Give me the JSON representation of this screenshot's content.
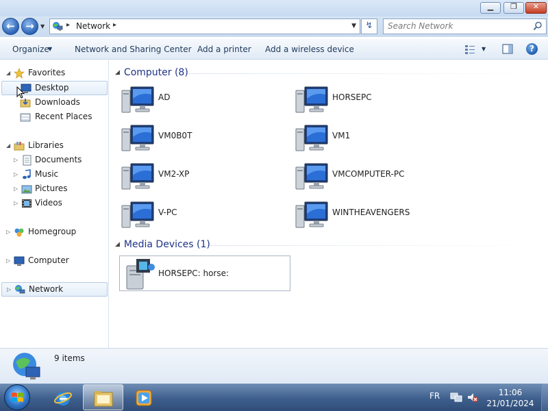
{
  "window": {
    "minimize_glyph": "▁",
    "maximize_glyph": "❐",
    "close_glyph": "✕"
  },
  "address": {
    "back_glyph": "←",
    "forward_glyph": "→",
    "sep_glyph": "▸",
    "location": "Network",
    "refresh_glyph": "↯"
  },
  "search": {
    "placeholder": "Search Network"
  },
  "toolbar": {
    "organize": "Organize",
    "network_sharing": "Network and Sharing Center",
    "add_printer": "Add a printer",
    "add_wireless": "Add a wireless device",
    "help_glyph": "?"
  },
  "nav": {
    "favorites": "Favorites",
    "desktop": "Desktop",
    "downloads": "Downloads",
    "recent_places": "Recent Places",
    "libraries": "Libraries",
    "documents": "Documents",
    "music": "Music",
    "pictures": "Pictures",
    "videos": "Videos",
    "homegroup": "Homegroup",
    "computer": "Computer",
    "network": "Network"
  },
  "content": {
    "computer_group": "Computer (8)",
    "computers": [
      {
        "name": "AD"
      },
      {
        "name": "HORSEPC"
      },
      {
        "name": "VM0B0T"
      },
      {
        "name": "VM1"
      },
      {
        "name": "VM2-XP"
      },
      {
        "name": "VMCOMPUTER-PC"
      },
      {
        "name": "V-PC"
      },
      {
        "name": "WINTHEAVENGERS"
      }
    ],
    "media_group": "Media Devices (1)",
    "media_devices": [
      {
        "name": "HORSEPC: horse:"
      }
    ]
  },
  "details": {
    "count": "9 items"
  },
  "taskbar": {
    "language": "FR",
    "time": "11:06",
    "date": "21/01/2024"
  },
  "colors": {
    "group_header": "#1e3287",
    "toolbar_text": "#1e395b",
    "taskbar": "#3e5f8d"
  }
}
